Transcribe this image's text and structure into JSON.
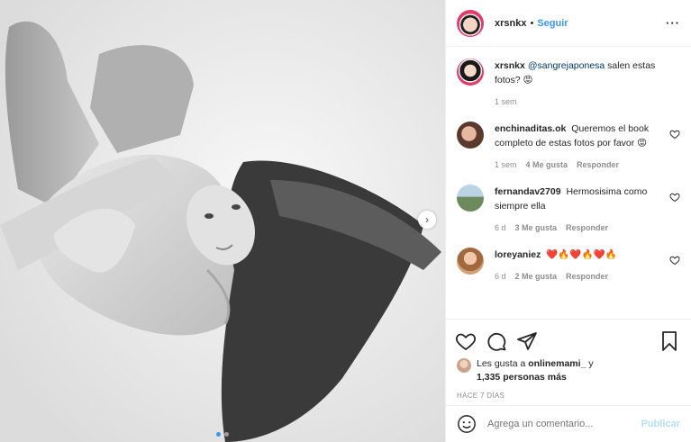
{
  "post": {
    "username": "xrsnkx",
    "separator": "•",
    "follow_label": "Seguir",
    "more_label": "···"
  },
  "caption": {
    "username": "xrsnkx",
    "mention": "@sangrejaponesa",
    "text": " salen estas fotos? 😡",
    "time": "1 sem"
  },
  "comments": [
    {
      "username": "enchinaditas.ok",
      "text": "Queremos el book completo de estas fotos por favor 😡",
      "time": "1 sem",
      "likes": "4 Me gusta",
      "reply": "Responder"
    },
    {
      "username": "fernandav2709",
      "text": "Hermosisima como siempre ella",
      "time": "6 d",
      "likes": "3 Me gusta",
      "reply": "Responder"
    },
    {
      "username": "loreyaniez",
      "text": "❤️🔥❤️🔥❤️🔥",
      "time": "6 d",
      "likes": "2 Me gusta",
      "reply": "Responder"
    }
  ],
  "likes": {
    "prefix": "Les gusta a ",
    "user": "onlinemami_",
    "conj": " y",
    "count": "1,335 personas más"
  },
  "timestamp": "HACE 7 DÍAS",
  "comment_box": {
    "placeholder": "Agrega un comentario...",
    "publish_label": "Publicar"
  },
  "carousel": {
    "next_icon": "chevron-right-icon",
    "current_index": 1,
    "total": 2
  },
  "colors": {
    "link": "#3897f0",
    "mention": "#00376b",
    "muted": "#8e8e8e",
    "publish_disabled": "#b2dffc"
  }
}
